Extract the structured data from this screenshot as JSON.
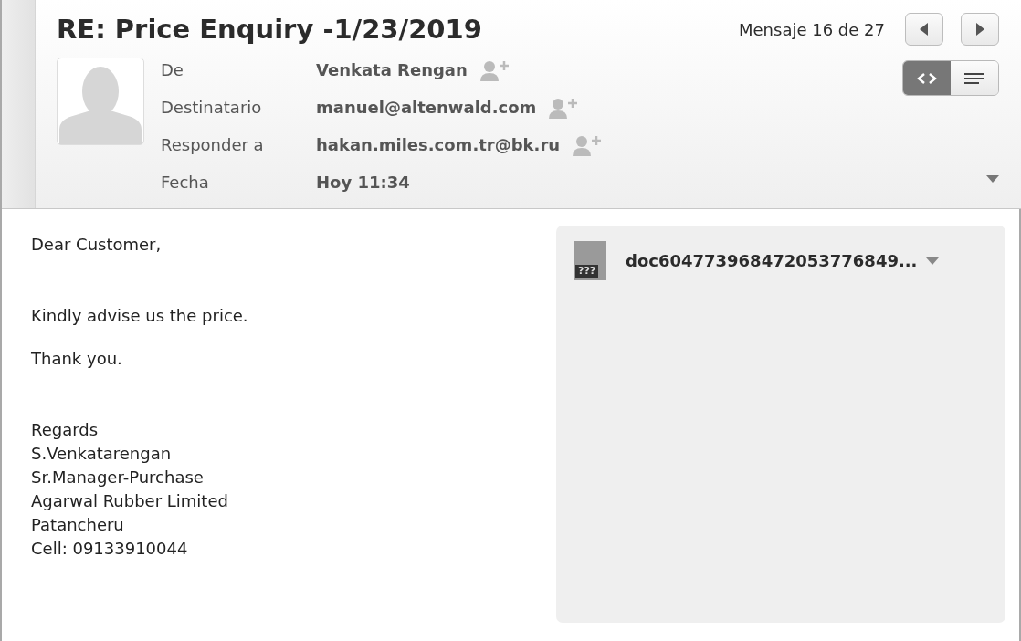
{
  "header": {
    "title": "RE: Price Enquiry -1/23/2019",
    "counter": "Mensaje 16 de 27",
    "fields": [
      {
        "label": "De",
        "value": "Venkata Rengan",
        "add_contact": true
      },
      {
        "label": "Destinatario",
        "value": "manuel@altenwald.com",
        "add_contact": true
      },
      {
        "label": "Responder a",
        "value": "hakan.miles.com.tr@bk.ru",
        "add_contact": true
      },
      {
        "label": "Fecha",
        "value": "Hoy 11:34",
        "add_contact": false
      }
    ],
    "view_modes": [
      {
        "kind": "source",
        "selected": true
      },
      {
        "kind": "text",
        "selected": false
      }
    ]
  },
  "body": {
    "paragraphs": [
      {
        "lines": [
          "Dear Customer,"
        ]
      },
      {
        "lines": [
          "Kindly advise us the price."
        ]
      },
      {
        "lines": [
          "Thank you."
        ]
      },
      {
        "lines": [
          "Regards",
          "S.Venkatarengan",
          "Sr.Manager-Purchase",
          "Agarwal Rubber Limited",
          "Patancheru",
          "Cell: 09133910044"
        ]
      }
    ]
  },
  "attachment": {
    "name": "doc604773968472053776849...",
    "icon_text": "???"
  }
}
